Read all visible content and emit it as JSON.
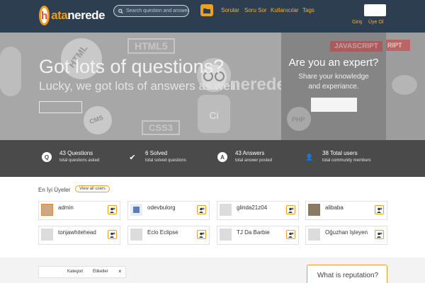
{
  "header": {
    "logo_mark": "h",
    "logo_text_a": "ata",
    "logo_text_b": "nerede",
    "search_placeholder": "Search question and answer...",
    "nav": [
      "Sorular",
      "Soru Sor",
      "Kullanıcılar",
      "Tags"
    ],
    "login": "Giriş",
    "register": "Üye Ol"
  },
  "hero": {
    "title": "Got lots of questions?",
    "subtitle": "Lucky, we got lots of answers as well!",
    "deco": [
      "HTML5",
      "HTML",
      "CSS3",
      "CMS",
      "PHP",
      "JAVASCRIPT",
      "nerede"
    ],
    "expert_title": "Are you an expert?",
    "expert_sub_1": "Share your knowledge",
    "expert_sub_2": "and experiance."
  },
  "stats": [
    {
      "icon": "Q",
      "main": "43 Questions",
      "sub": "total questions asked"
    },
    {
      "icon": "✔",
      "main": "6 Solved",
      "sub": "total solved questions"
    },
    {
      "icon": "A",
      "main": "43 Answers",
      "sub": "total answer posted"
    },
    {
      "icon": "👤",
      "main": "38 Total users",
      "sub": "total community members"
    }
  ],
  "users": {
    "title": "En İyi Üyeler",
    "view_all": "View all users",
    "list": [
      "admin",
      "odevbulorg",
      "glinda21z04",
      "alibaba",
      "tonjawhitehead",
      "Eclo Eclipse",
      "TJ Da Barbie",
      "Oğuzhan Işleyen"
    ]
  },
  "bottom": {
    "tab_category": "Kategori",
    "tab_tags": "Etiketler",
    "tab_close": "×",
    "reputation": "What is reputation?"
  },
  "colors": {
    "accent": "#f0a020",
    "header": "#2c3e50",
    "stats_bg": "#4a4a4a"
  }
}
